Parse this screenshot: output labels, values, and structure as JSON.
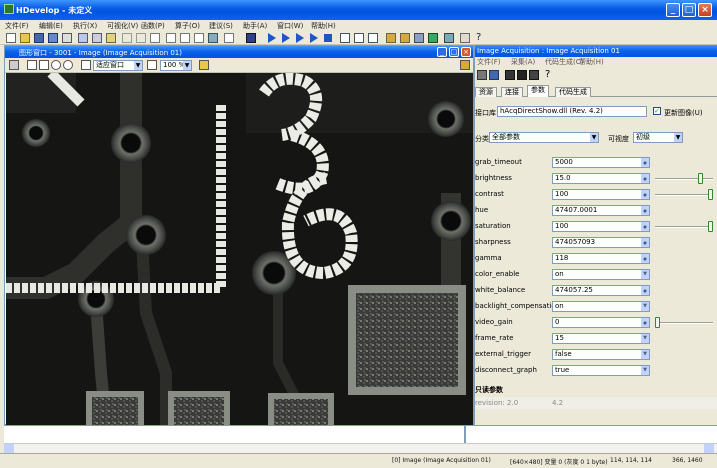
{
  "app": {
    "title": "HDevelop - 未定义"
  },
  "menu": [
    "文件(F)",
    "编辑(E)",
    "执行(X)",
    "可视化(V)",
    "函数(P)",
    "算子(O)",
    "建议(S)",
    "助手(A)",
    "窗口(W)",
    "帮助(H)"
  ],
  "graphics": {
    "title": "图形窗口 - 3001 - Image (Image Acquisition 01)",
    "mode_combo": "适应窗口",
    "zoom_combo": "100 %"
  },
  "acquisition": {
    "title": "Image Acquisition : Image Acquisition 01",
    "menu": [
      "文件(F)",
      "采集(A)",
      "代码生成(C)",
      "帮助(H)"
    ],
    "tabs": [
      "资源",
      "连接",
      "参数",
      "代码生成"
    ],
    "active_tab": "参数",
    "interface_label": "接口库",
    "interface_value": "hAcqDirectShow.dll (Rev. 4.2)",
    "update_label": "更新图像(U)",
    "group_label": "分类",
    "group_value": "全部参数",
    "visibility_label": "可视度",
    "visibility_value": "初级",
    "params": [
      {
        "name": "grab_timeout",
        "value": "5000",
        "control": "spin"
      },
      {
        "name": "brightness",
        "value": "15.0",
        "control": "spin",
        "slider": 0.82
      },
      {
        "name": "contrast",
        "value": "100",
        "control": "spin",
        "slider": 1.0
      },
      {
        "name": "hue",
        "value": "47407.0001",
        "control": "spin"
      },
      {
        "name": "saturation",
        "value": "100",
        "control": "spin",
        "slider": 1.0
      },
      {
        "name": "sharpness",
        "value": "474057093",
        "control": "spin"
      },
      {
        "name": "gamma",
        "value": "118",
        "control": "spin"
      },
      {
        "name": "color_enable",
        "value": "on",
        "control": "dropdown"
      },
      {
        "name": "white_balance",
        "value": "474057.25",
        "control": "spin"
      },
      {
        "name": "backlight_compensation",
        "value": "on",
        "control": "dropdown"
      },
      {
        "name": "video_gain",
        "value": "0",
        "control": "spin",
        "slider": 0.0
      },
      {
        "name": "frame_rate",
        "value": "15",
        "control": "dropdown"
      },
      {
        "name": "external_trigger",
        "value": "false",
        "control": "dropdown"
      },
      {
        "name": "disconnect_graph",
        "value": "true",
        "control": "dropdown"
      }
    ],
    "section_label": "只读参数",
    "readonly_first": "revision: 2.0",
    "readonly_value": "4.2"
  },
  "status": {
    "image_info": "[0] Image (Image Acquisition 01)",
    "image_size": "[640×480] 变量 0 (灰度 0 1 byte)",
    "rgb": "114, 114, 114",
    "coords": "366, 1460"
  }
}
